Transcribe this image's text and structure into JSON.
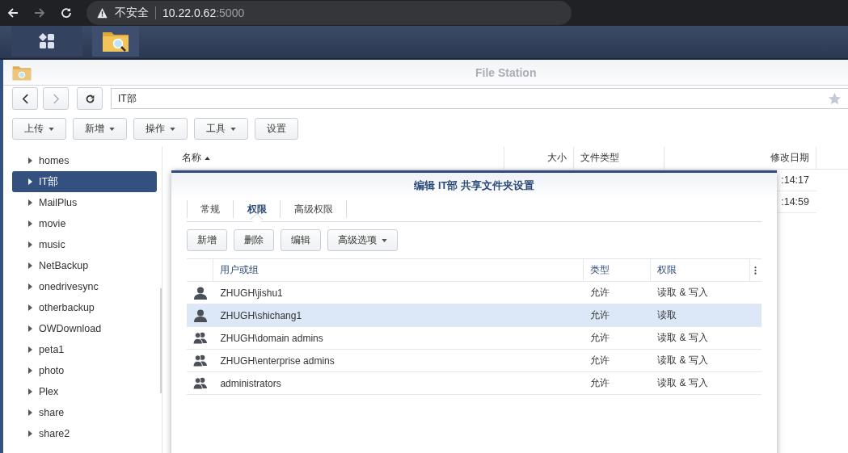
{
  "browser": {
    "security_label": "不安全",
    "url_host": "10.22.0.62",
    "url_port": ":5000"
  },
  "taskbar": {
    "items": [
      {
        "kind": "apps",
        "selected": false
      },
      {
        "kind": "file-station",
        "selected": true
      }
    ]
  },
  "window": {
    "title": "File Station"
  },
  "path_field": {
    "value": "IT部"
  },
  "toolbar": [
    {
      "label": "上传",
      "dropdown": true
    },
    {
      "label": "新增",
      "dropdown": true
    },
    {
      "label": "操作",
      "dropdown": true
    },
    {
      "label": "工具",
      "dropdown": true
    },
    {
      "label": "设置",
      "dropdown": false
    }
  ],
  "sidebar": {
    "items": [
      {
        "label": "homes",
        "selected": false
      },
      {
        "label": "IT部",
        "selected": true
      },
      {
        "label": "MailPlus",
        "selected": false
      },
      {
        "label": "movie",
        "selected": false
      },
      {
        "label": "music",
        "selected": false
      },
      {
        "label": "NetBackup",
        "selected": false
      },
      {
        "label": "onedrivesync",
        "selected": false
      },
      {
        "label": "otherbackup",
        "selected": false
      },
      {
        "label": "OWDownload",
        "selected": false
      },
      {
        "label": "peta1",
        "selected": false
      },
      {
        "label": "photo",
        "selected": false
      },
      {
        "label": "Plex",
        "selected": false
      },
      {
        "label": "share",
        "selected": false
      },
      {
        "label": "share2",
        "selected": false
      }
    ]
  },
  "file_list": {
    "columns": [
      "名称",
      "大小",
      "文件类型",
      "修改日期"
    ],
    "rows": [
      {
        "modified": ":14:17"
      },
      {
        "modified": ":14:59"
      }
    ]
  },
  "dialog": {
    "title": "编辑 IT部 共享文件夹设置",
    "tabs": [
      {
        "label": "常规",
        "selected": false
      },
      {
        "label": "权限",
        "selected": true
      },
      {
        "label": "高级权限",
        "selected": false
      }
    ],
    "buttons": [
      {
        "label": "新增",
        "dropdown": false
      },
      {
        "label": "删除",
        "dropdown": false
      },
      {
        "label": "编辑",
        "dropdown": false
      },
      {
        "label": "高级选项",
        "dropdown": true
      }
    ],
    "columns": [
      "用户或组",
      "类型",
      "权限"
    ],
    "rows": [
      {
        "kind": "user",
        "name": "ZHUGH\\jishu1",
        "type": "允许",
        "permission": "读取 & 写入",
        "selected": false
      },
      {
        "kind": "user",
        "name": "ZHUGH\\shichang1",
        "type": "允许",
        "permission": "读取",
        "selected": true
      },
      {
        "kind": "group",
        "name": "ZHUGH\\domain admins",
        "type": "允许",
        "permission": "读取 & 写入",
        "selected": false
      },
      {
        "kind": "group",
        "name": "ZHUGH\\enterprise admins",
        "type": "允许",
        "permission": "读取 & 写入",
        "selected": false
      },
      {
        "kind": "group",
        "name": "administrators",
        "type": "允许",
        "permission": "读取 & 写入",
        "selected": false
      }
    ]
  }
}
